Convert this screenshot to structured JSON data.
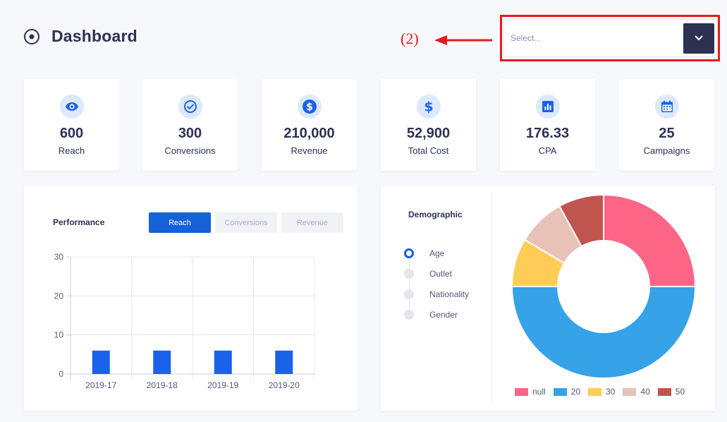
{
  "header": {
    "title": "Dashboard",
    "icon": "radio-target-icon"
  },
  "annotation": {
    "label": "(2)",
    "color": "#e31b1b"
  },
  "select": {
    "placeholder": "Select...",
    "icon": "chevron-down-icon"
  },
  "stats": [
    {
      "value": "600",
      "label": "Reach",
      "icon": "eye-icon"
    },
    {
      "value": "300",
      "label": "Conversions",
      "icon": "check-circle-icon"
    },
    {
      "value": "210,000",
      "label": "Revenue",
      "icon": "dollar-icon"
    },
    {
      "value": "52,900",
      "label": "Total Cost",
      "icon": "dollar-icon"
    },
    {
      "value": "176.33",
      "label": "CPA",
      "icon": "bar-chart-icon"
    },
    {
      "value": "25",
      "label": "Campaigns",
      "icon": "calendar-icon"
    }
  ],
  "performance": {
    "title": "Performance",
    "tabs": [
      {
        "label": "Reach",
        "active": true
      },
      {
        "label": "Conversions",
        "active": false
      },
      {
        "label": "Revenue",
        "active": false
      }
    ]
  },
  "demographic": {
    "title": "Demographic",
    "options": [
      {
        "label": "Age",
        "checked": true
      },
      {
        "label": "Outlet",
        "checked": false
      },
      {
        "label": "Nationality",
        "checked": false
      },
      {
        "label": "Gender",
        "checked": false
      }
    ]
  },
  "chart_data": [
    {
      "type": "bar",
      "categories": [
        "2019-17",
        "2019-18",
        "2019-19",
        "2019-20"
      ],
      "values": [
        6,
        6,
        6,
        6
      ],
      "ylim": [
        0,
        30
      ],
      "yticks": [
        0,
        10,
        20,
        30
      ],
      "grid": true,
      "color": "#1a63e8"
    },
    {
      "type": "pie",
      "donut": true,
      "labels": [
        "null",
        "20",
        "30",
        "40",
        "50"
      ],
      "values": [
        25,
        50,
        8.5,
        8.5,
        8
      ],
      "colors": [
        "#fd6586",
        "#36a2e8",
        "#ffcd56",
        "#e8c2b8",
        "#c0554f"
      ],
      "legend": "bottom"
    }
  ]
}
